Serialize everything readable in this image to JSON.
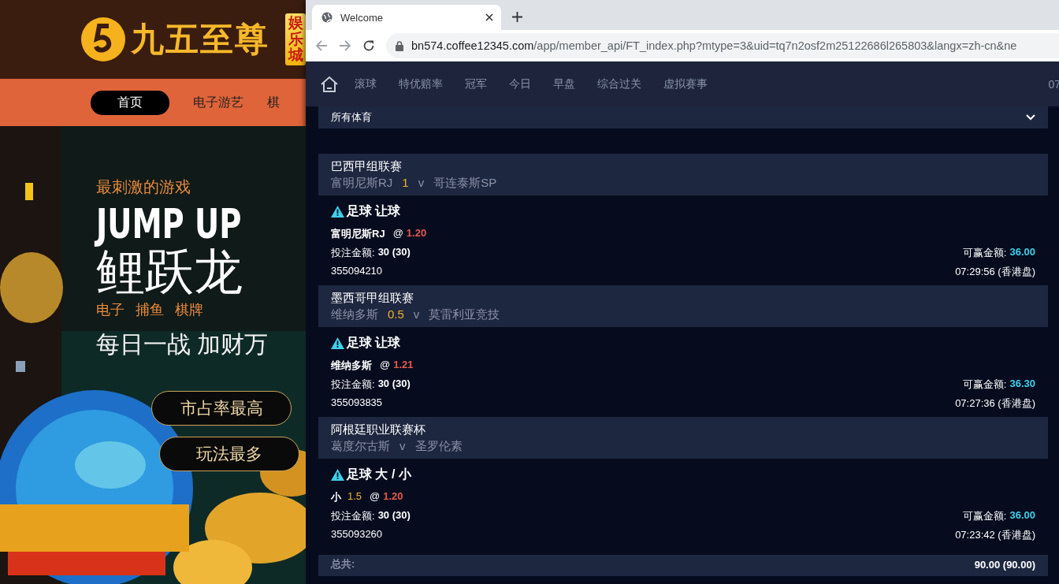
{
  "left_site": {
    "logo": {
      "name": "九五至尊",
      "badge": "娱乐城"
    },
    "nav": [
      {
        "label": "首页",
        "selected": true
      },
      {
        "label": "电子游艺",
        "selected": false
      },
      {
        "label": "棋",
        "selected": false
      }
    ],
    "banner": {
      "kicker": "最刺激的游戏",
      "headline": "JUMP UP",
      "title": "鲤跃龙",
      "categories": [
        "电子",
        "捕鱼",
        "棋牌"
      ],
      "slogan": "每日一战 加财万",
      "buttons": [
        "市占率最高",
        "玩法最多"
      ]
    }
  },
  "browser": {
    "tab": {
      "title": "Welcome"
    },
    "url": {
      "host": "bn574.coffee12345.com",
      "path": "/app/member_api/FT_index.php?mtype=3&uid=tq7n2osf2m25122686l265803&langx=zh-cn&ne"
    }
  },
  "site": {
    "nav": [
      "滚球",
      "特优赔率",
      "冠军",
      "今日",
      "早盘",
      "综合过关",
      "虚拟赛事"
    ],
    "clock": "07",
    "filter": "所有体育",
    "bets": [
      {
        "league": "巴西甲组联赛",
        "home": "富明尼斯RJ",
        "handicap": "1",
        "vs": "v",
        "away": "哥连泰斯SP",
        "title": "足球 让球",
        "pick": "富明尼斯RJ",
        "at": "@",
        "odds": "1.20",
        "stake_label": "投注金额:",
        "stake": "30 (30)",
        "win_label": "可赢金额:",
        "win": "36.00",
        "ticket": "355094210",
        "time": "07:29:56 (香港盘)"
      },
      {
        "league": "墨西哥甲组联赛",
        "home": "维纳多斯",
        "handicap": "0.5",
        "vs": "v",
        "away": "莫雷利亚竞技",
        "title": "足球 让球",
        "pick": "维纳多斯",
        "at": "@",
        "odds": "1.21",
        "stake_label": "投注金额:",
        "stake": "30 (30)",
        "win_label": "可赢金额:",
        "win": "36.30",
        "ticket": "355093835",
        "time": "07:27:36 (香港盘)"
      },
      {
        "league": "阿根廷职业联赛杯",
        "home": "葛度尔古斯",
        "vs": "v",
        "away": "圣罗伦素",
        "title": "足球 大 / 小",
        "pick": "小",
        "line": "1.5",
        "at": "@",
        "odds": "1.20",
        "stake_label": "投注金额:",
        "stake": "30 (30)",
        "win_label": "可赢金额:",
        "win": "36.00",
        "ticket": "355093260",
        "time": "07:23:42 (香港盘)"
      }
    ],
    "total": {
      "label": "总共:",
      "value": "90.00 (90.00)"
    }
  }
}
